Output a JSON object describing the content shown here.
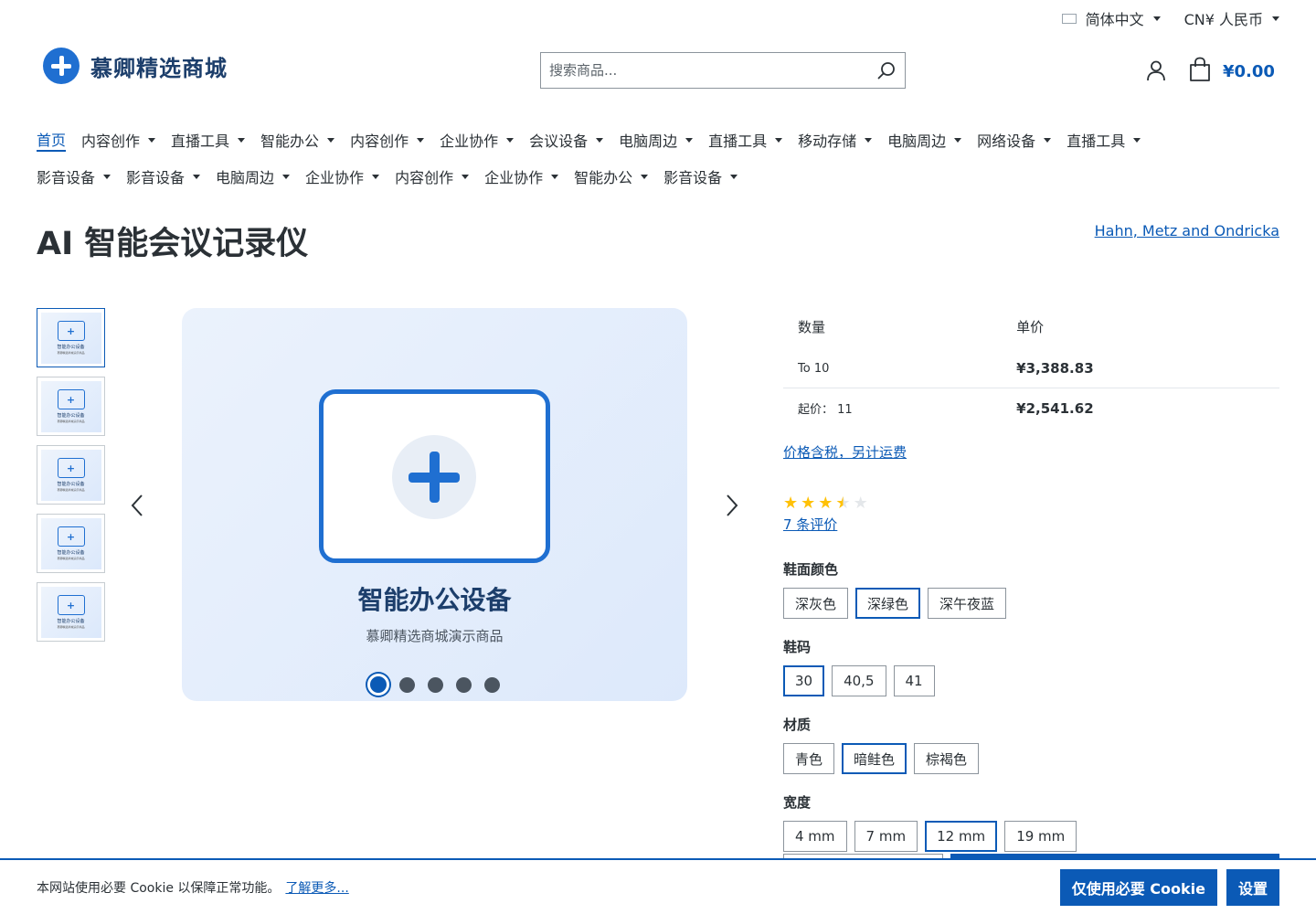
{
  "topbar": {
    "language": "简体中文",
    "currency": "CN¥ 人民币"
  },
  "header": {
    "logo_text": "慕卿精选商城",
    "search_placeholder": "搜索商品...",
    "cart_total": "¥0.00"
  },
  "nav": {
    "items": [
      {
        "label": "首页"
      },
      {
        "label": "内容创作"
      },
      {
        "label": "直播工具"
      },
      {
        "label": "智能办公"
      },
      {
        "label": "内容创作"
      },
      {
        "label": "企业协作"
      },
      {
        "label": "会议设备"
      },
      {
        "label": "电脑周边"
      },
      {
        "label": "直播工具"
      },
      {
        "label": "移动存储"
      },
      {
        "label": "电脑周边"
      },
      {
        "label": "网络设备"
      },
      {
        "label": "直播工具"
      },
      {
        "label": "影音设备"
      },
      {
        "label": "影音设备"
      },
      {
        "label": "电脑周边"
      },
      {
        "label": "企业协作"
      },
      {
        "label": "内容创作"
      },
      {
        "label": "企业协作"
      },
      {
        "label": "智能办公"
      },
      {
        "label": "影音设备"
      }
    ]
  },
  "product": {
    "title": "AI 智能会议记录仪",
    "manufacturer": "Hahn, Metz and Ondricka"
  },
  "gallery": {
    "title": "智能办公设备",
    "subtitle": "慕卿精选商城演示商品",
    "thumb_title": "智能办公设备",
    "thumb_subtitle": "慕卿精选商城演示商品",
    "active_index": 1,
    "count": 5
  },
  "pricing": {
    "col_qty": "数量",
    "col_price": "单价",
    "rows": [
      {
        "qty": "To 10",
        "price": "¥3,388.83"
      },
      {
        "qty": "起价： 11",
        "price": "¥2,541.62"
      }
    ],
    "tax_note": "价格含税，另计运费"
  },
  "rating": {
    "value": 3.5,
    "max": 5,
    "reviews_text": "7 条评价"
  },
  "options": {
    "color": {
      "label": "鞋面颜色",
      "values": [
        "深灰色",
        "深绿色",
        "深午夜蓝"
      ],
      "selected": 1
    },
    "size": {
      "label": "鞋码",
      "values": [
        "30",
        "40,5",
        "41"
      ],
      "selected": 0
    },
    "material": {
      "label": "材质",
      "values": [
        "青色",
        "暗鲑色",
        "棕褐色"
      ],
      "selected": 1
    },
    "width": {
      "label": "宽度",
      "values": [
        "4 mm",
        "7 mm",
        "12 mm",
        "19 mm"
      ],
      "selected": 2
    }
  },
  "cookie": {
    "text": "本网站使用必要 Cookie 以保障正常功能。",
    "link": "了解更多...",
    "accept_label": "仅使用必要 Cookie",
    "settings_label": "设置"
  },
  "colors": {
    "accent": "#0b5ab6",
    "brand": "#1f6fd1",
    "star": "#ffc107"
  }
}
